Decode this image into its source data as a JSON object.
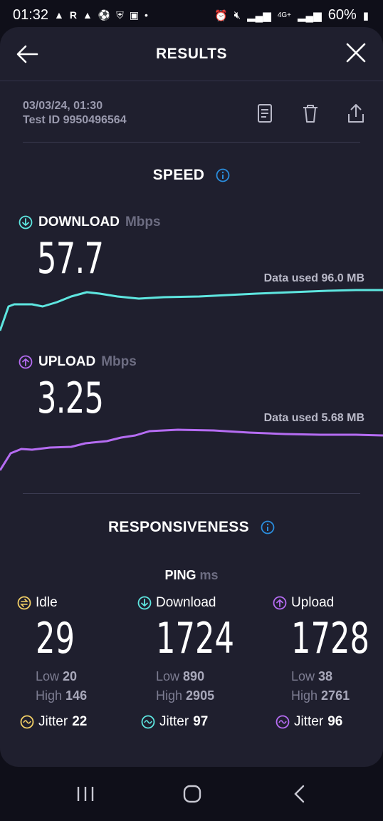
{
  "status_bar": {
    "time": "01:32",
    "battery": "60%",
    "network": "4G+"
  },
  "header": {
    "title": "RESULTS"
  },
  "test": {
    "date": "03/03/24, 01:30",
    "test_id": "Test ID 9950496564"
  },
  "speed": {
    "section_title": "SPEED",
    "download": {
      "label": "DOWNLOAD",
      "unit": "Mbps",
      "value": "57.7",
      "data_used": "Data used 96.0 MB",
      "color": "#5ee6e0"
    },
    "upload": {
      "label": "UPLOAD",
      "unit": "Mbps",
      "value": "3.25",
      "data_used": "Data used 5.68 MB",
      "color": "#b56cf2"
    }
  },
  "responsiveness": {
    "section_title": "RESPONSIVENESS",
    "ping_label": "PING",
    "ping_unit": "ms",
    "idle": {
      "label": "Idle",
      "value": "29",
      "low_label": "Low",
      "low": "20",
      "high_label": "High",
      "high": "146",
      "jitter_label": "Jitter",
      "jitter": "22",
      "color": "#f2cf66"
    },
    "download": {
      "label": "Download",
      "value": "1724",
      "low_label": "Low",
      "low": "890",
      "high_label": "High",
      "high": "2905",
      "jitter_label": "Jitter",
      "jitter": "97",
      "color": "#5ee6e0"
    },
    "upload": {
      "label": "Upload",
      "value": "1728",
      "low_label": "Low",
      "low": "38",
      "high_label": "High",
      "high": "2761",
      "jitter_label": "Jitter",
      "jitter": "96",
      "color": "#b56cf2"
    }
  },
  "colors": {
    "info_blue": "#2a8ddd",
    "background": "#1f1f2e"
  }
}
